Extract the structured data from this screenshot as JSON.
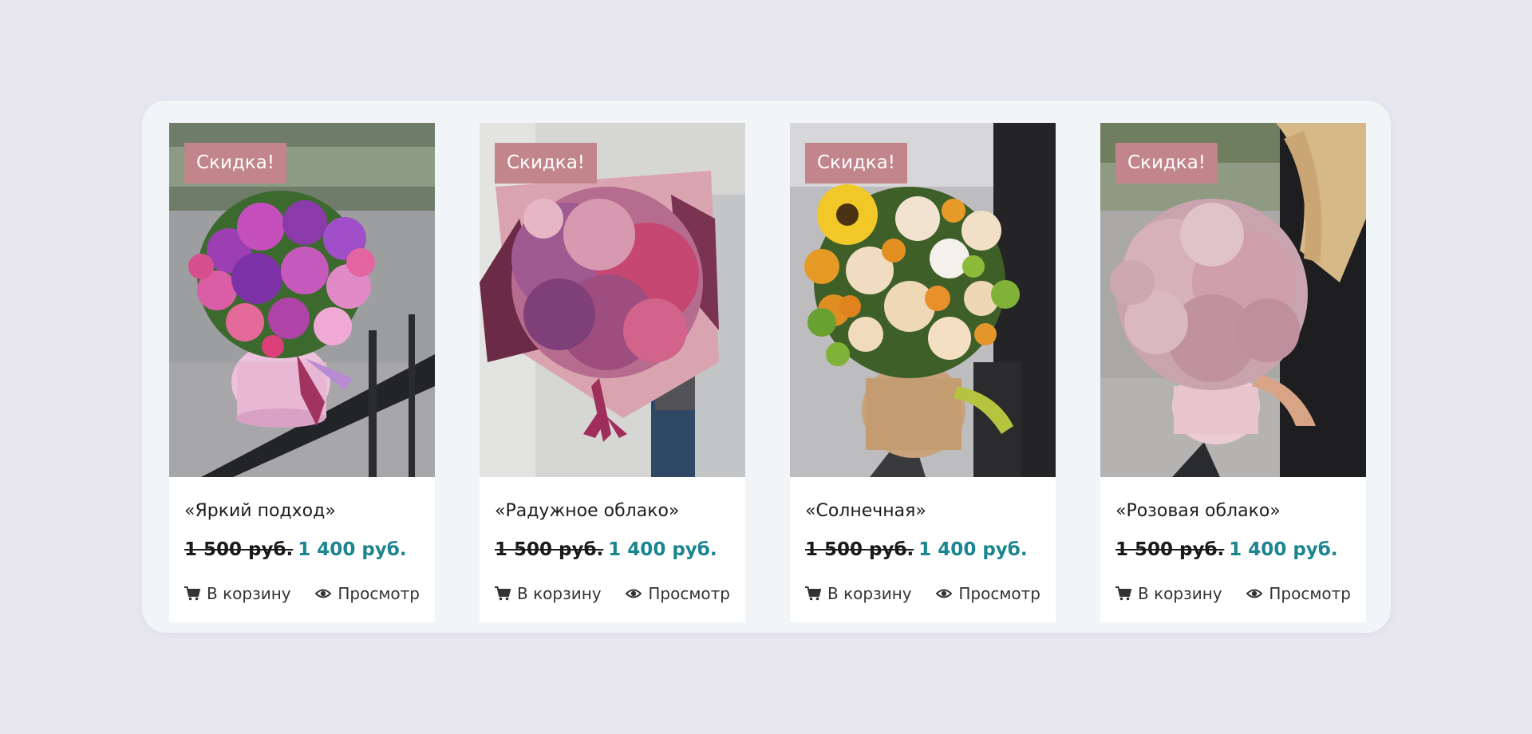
{
  "colors": {
    "background": "#e8e7f0",
    "panel": "#f1f5f8",
    "badge": "#c1858b",
    "sale_price": "#1b8590"
  },
  "products": [
    {
      "badge": "Скидка!",
      "title": "«Яркий подход»",
      "old_price": "1 500 руб.",
      "new_price": "1 400 руб.",
      "cart_label": "В корзину",
      "view_label": "Просмотр",
      "cart_icon": "cart-icon",
      "view_icon": "eye-icon"
    },
    {
      "badge": "Скидка!",
      "title": "«Радужное облако»",
      "old_price": "1 500 руб.",
      "new_price": "1 400 руб.",
      "cart_label": "В корзину",
      "view_label": "Просмотр",
      "cart_icon": "cart-icon",
      "view_icon": "eye-icon"
    },
    {
      "badge": "Скидка!",
      "title": "«Солнечная»",
      "old_price": "1 500 руб.",
      "new_price": "1 400 руб.",
      "cart_label": "В корзину",
      "view_label": "Просмотр",
      "cart_icon": "cart-icon",
      "view_icon": "eye-icon"
    },
    {
      "badge": "Скидка!",
      "title": "«Розовая облако»",
      "old_price": "1 500 руб.",
      "new_price": "1 400 руб.",
      "cart_label": "В корзину",
      "view_label": "Просмотр",
      "cart_icon": "cart-icon",
      "view_icon": "eye-icon"
    }
  ]
}
